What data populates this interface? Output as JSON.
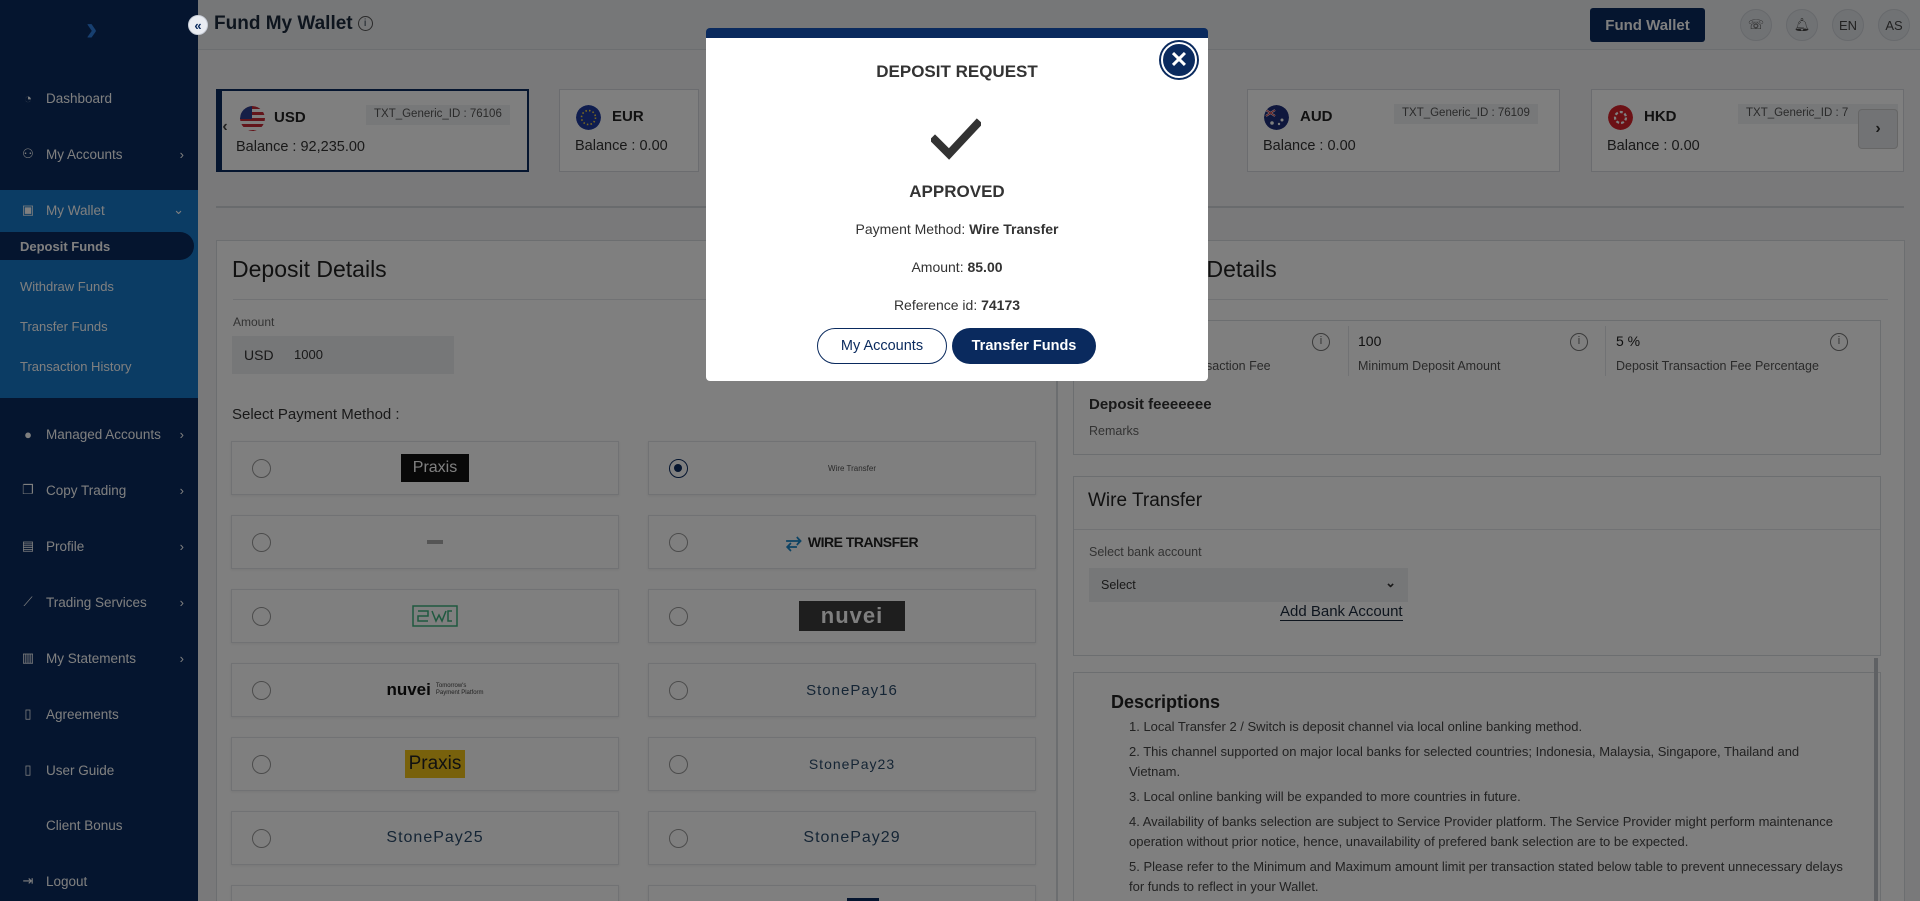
{
  "page": {
    "title": "Fund My Wallet"
  },
  "topbar": {
    "fund_wallet": "Fund Wallet",
    "language": "EN",
    "user_initials": "AS"
  },
  "sidebar": {
    "items": [
      {
        "label": "Dashboard"
      },
      {
        "label": "My Accounts"
      },
      {
        "label": "My Wallet"
      },
      {
        "label": "Managed Accounts"
      },
      {
        "label": "Copy Trading"
      },
      {
        "label": "Profile"
      },
      {
        "label": "Trading Services"
      },
      {
        "label": "My Statements"
      },
      {
        "label": "Agreements"
      },
      {
        "label": "User Guide"
      },
      {
        "label": "Client Bonus"
      },
      {
        "label": "Logout"
      }
    ],
    "wallet_sub": [
      {
        "label": "Deposit Funds"
      },
      {
        "label": "Withdraw Funds"
      },
      {
        "label": "Transfer Funds"
      },
      {
        "label": "Transaction History"
      }
    ]
  },
  "currencies": [
    {
      "code": "USD",
      "id": "TXT_Generic_ID : 76106",
      "balance": "Balance : 92,235.00"
    },
    {
      "code": "EUR",
      "balance": "Balance : 0.00"
    },
    {
      "code": "AUD",
      "id": "TXT_Generic_ID : 76109",
      "balance": "Balance : 0.00"
    },
    {
      "code": "HKD",
      "id": "TXT_Generic_ID : 7",
      "balance": "Balance : 0.00"
    }
  ],
  "deposit": {
    "title": "Deposit Details",
    "amount_label": "Amount",
    "currency": "USD",
    "amount_value": "1000",
    "select_method_label": "Select Payment Method :"
  },
  "payment_methods": {
    "praxis": "Praxis",
    "wire_small": "Wire Transfer",
    "wire_transfer_logo": "WIRE TRANSFER",
    "nuvei": "nuvei",
    "nuvei_tag_1": "Tomorrow's",
    "nuvei_tag_2": "Payment Platform",
    "stonepay16": "StonePay16",
    "praxis_yellow": "Praxis",
    "stonepay23": "StonePay23",
    "stonepay25": "StonePay25",
    "stonepay29": "StonePay29"
  },
  "gateway": {
    "title_visible": "teway Details",
    "fee_label_visible": "saction Fee",
    "min_deposit_value": "100",
    "min_deposit_label": "Minimum Deposit Amount",
    "fee_pct_value": "5 %",
    "fee_pct_label": "Deposit Transaction Fee Percentage",
    "remark_title": "Deposit feeeeeee",
    "remark_label": "Remarks"
  },
  "wire": {
    "title": "Wire Transfer",
    "bank_label": "Select bank account",
    "select_value": "Select",
    "add_bank": "Add Bank Account"
  },
  "descriptions": {
    "title": "Descriptions",
    "items": [
      "1. Local Transfer 2 / Switch is deposit channel via local online banking method.",
      "2. This channel supported on major local banks for selected countries; Indonesia, Malaysia, Singapore, Thailand and Vietnam.",
      "3. Local online banking will be expanded to more countries in future.",
      "4. Availability of banks selection are subject to Service Provider platform. The Service Provider might perform maintenance operation without prior notice, hence, unavailability of prefered bank selection are to be expected.",
      "5. Please refer to the Minimum and Maximum amount limit per transaction stated below table to prevent unnecessary delays for funds to reflect in your Wallet."
    ]
  },
  "modal": {
    "title": "DEPOSIT REQUEST",
    "status": "APPROVED",
    "method_label": "Payment Method:",
    "method_value": "Wire Transfer",
    "amount_label": "Amount:",
    "amount_value": "85.00",
    "ref_label": "Reference id:",
    "ref_value": "74173",
    "btn_accounts": "My Accounts",
    "btn_transfer": "Transfer Funds"
  },
  "colors": {
    "primary": "#0a2a5e",
    "accent": "#1778c8"
  }
}
